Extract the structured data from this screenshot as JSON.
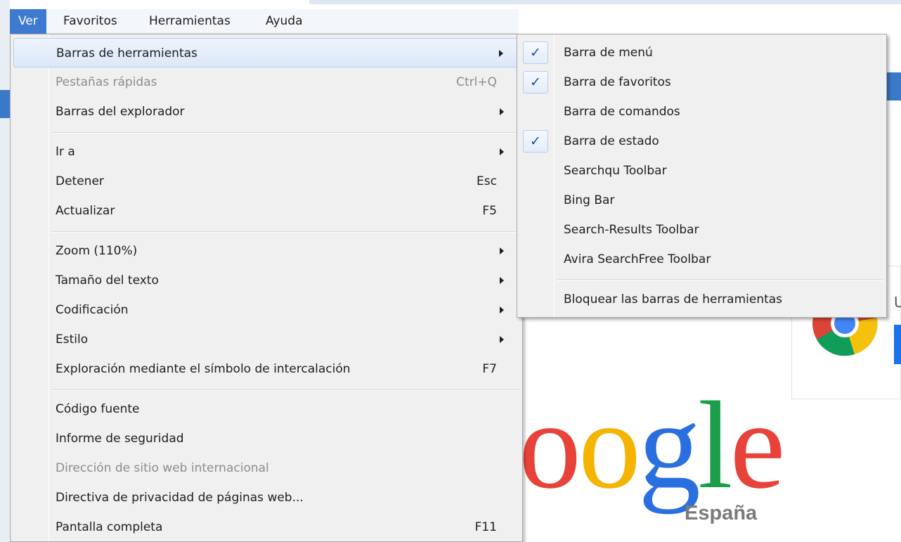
{
  "menubar": {
    "items": [
      {
        "label": "Ver",
        "active": true
      },
      {
        "label": "Favoritos",
        "active": false
      },
      {
        "label": "Herramientas",
        "active": false
      },
      {
        "label": "Ayuda",
        "active": false
      }
    ]
  },
  "view_menu": {
    "items": [
      {
        "label": "Barras de herramientas",
        "shortcut": "",
        "submenu": true
      },
      {
        "label": "Pestañas rápidas",
        "shortcut": "Ctrl+Q",
        "disabled": true
      },
      {
        "label": "Barras del explorador",
        "shortcut": "",
        "submenu": true
      },
      {
        "label": "Ir a",
        "shortcut": "",
        "submenu": true
      },
      {
        "label": "Detener",
        "shortcut": "Esc"
      },
      {
        "label": "Actualizar",
        "shortcut": "F5"
      },
      {
        "label": "Zoom (110%)",
        "shortcut": "",
        "submenu": true
      },
      {
        "label": "Tamaño del texto",
        "shortcut": "",
        "submenu": true
      },
      {
        "label": "Codificación",
        "shortcut": "",
        "submenu": true
      },
      {
        "label": "Estilo",
        "shortcut": "",
        "submenu": true
      },
      {
        "label": "Exploración mediante el símbolo de intercalación",
        "shortcut": "F7"
      },
      {
        "label": "Código fuente",
        "shortcut": ""
      },
      {
        "label": "Informe de seguridad",
        "shortcut": ""
      },
      {
        "label": "Dirección de sitio web internacional",
        "shortcut": "",
        "disabled": true
      },
      {
        "label": "Directiva de privacidad de páginas web...",
        "shortcut": ""
      },
      {
        "label": "Pantalla completa",
        "shortcut": "F11"
      }
    ]
  },
  "toolbars_submenu": {
    "check_glyph": "✓",
    "items": [
      {
        "label": "Barra de menú",
        "checked": true
      },
      {
        "label": "Barra de favoritos",
        "checked": true
      },
      {
        "label": "Barra de comandos",
        "checked": false
      },
      {
        "label": "Barra de estado",
        "checked": true
      },
      {
        "label": "Searchqu Toolbar",
        "checked": false
      },
      {
        "label": "Bing Bar",
        "checked": false
      },
      {
        "label": "Search-Results Toolbar",
        "checked": false
      },
      {
        "label": "Avira SearchFree Toolbar",
        "checked": false
      },
      {
        "label": "Bloquear las barras de herramientas",
        "checked": false
      }
    ]
  },
  "page": {
    "logo_letters": [
      "o",
      "o",
      "g",
      "l",
      "e"
    ],
    "logo_colors": [
      "#e8433a",
      "#f5b400",
      "#2a6fe0",
      "#1a9e49",
      "#e8433a"
    ],
    "logo_subtitle": "España",
    "card_letter": "U"
  },
  "colors": {
    "menu_active": "#3d7ad0",
    "menu_background": "#f0f0f0",
    "check_color": "#1b4fa5"
  }
}
